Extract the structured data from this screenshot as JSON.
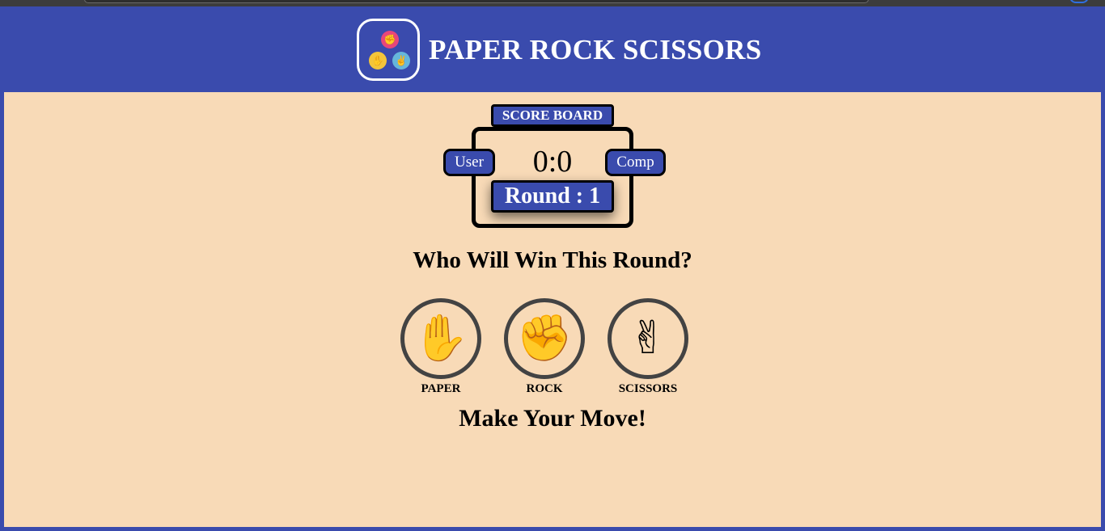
{
  "header": {
    "title": "PAPER ROCK SCISSORS",
    "logo_icons": [
      "rock-icon",
      "paper-icon",
      "scissors-icon"
    ],
    "logo_glyphs": [
      "✊",
      "✋",
      "✌"
    ]
  },
  "scoreboard": {
    "label": "SCORE BOARD",
    "user_label": "User",
    "comp_label": "Comp",
    "score": "0:0",
    "round": "Round : 1"
  },
  "prompt": "Who Will Win This Round?",
  "choices": [
    {
      "name": "paper",
      "label": "PAPER",
      "icon": "hand-paper-icon",
      "glyph": "✋"
    },
    {
      "name": "rock",
      "label": "ROCK",
      "icon": "hand-rock-icon",
      "glyph": "✊"
    },
    {
      "name": "scissors",
      "label": "SCISSORS",
      "icon": "hand-scissors-icon",
      "glyph": "✌"
    }
  ],
  "status": "Make Your Move!",
  "colors": {
    "primary": "#3a4bad",
    "background": "#f8dab7",
    "border": "#000000",
    "circle_border": "#434343"
  }
}
